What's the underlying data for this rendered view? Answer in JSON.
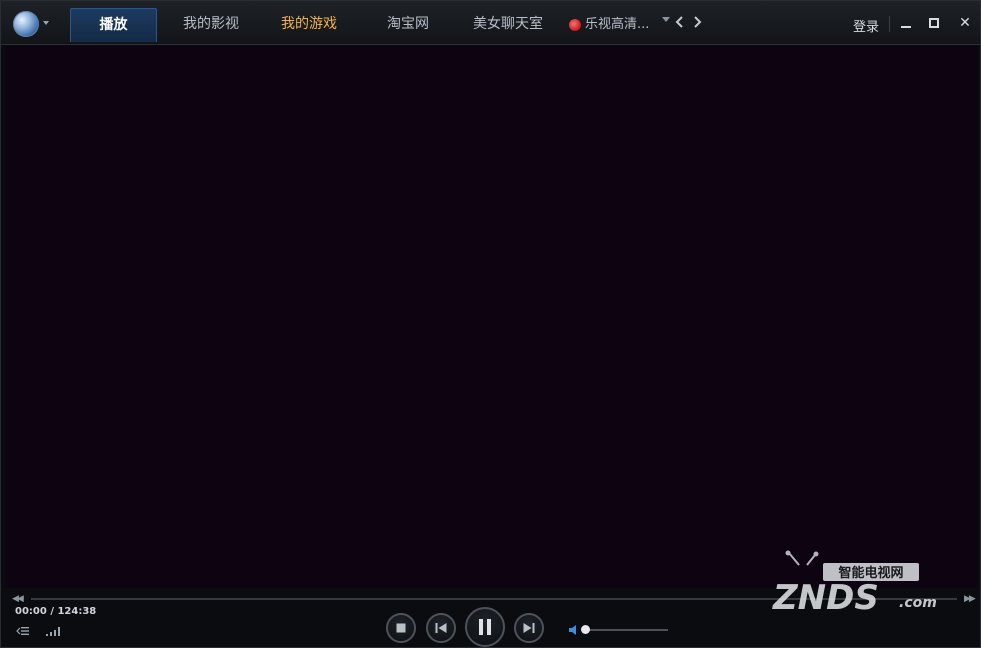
{
  "nav": {
    "tabs": [
      {
        "label": "播放",
        "active": true
      },
      {
        "label": "我的影视"
      },
      {
        "label": "我的游戏",
        "highlight": true
      },
      {
        "label": "淘宝网"
      },
      {
        "label": "美女聊天室"
      },
      {
        "label": "乐视高清...",
        "icon": "letv-icon"
      }
    ]
  },
  "window": {
    "login_label": "登录",
    "close_glyph": "✕"
  },
  "player": {
    "current_time": "00:00",
    "total_time": "/ 124:38",
    "progress_fraction": 0.0,
    "volume_fraction": 0.0,
    "seek_back_glyph": "◀◀",
    "seek_forward_glyph": "▶▶"
  },
  "colors": {
    "accent": "#f3b34a",
    "video_bg": "#0e0310",
    "active_tab": "#1c3b62"
  },
  "watermark": {
    "brand": "ZNDS",
    "suffix": ".com",
    "tagline": "智能电视网"
  }
}
